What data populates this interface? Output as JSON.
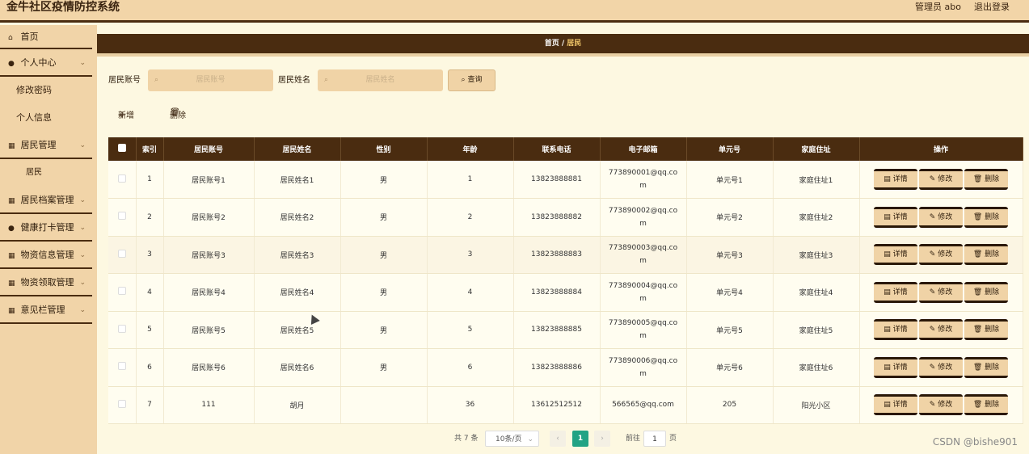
{
  "header": {
    "title": "金牛社区疫情防控系统",
    "user": "管理员 abo",
    "logout": "退出登录"
  },
  "sidebar": {
    "home": "首页",
    "personal_center": "个人中心",
    "change_password": "修改密码",
    "personal_info": "个人信息",
    "resident_mgmt": "居民管理",
    "resident": "居民",
    "resident_archive_mgmt": "居民档案管理",
    "health_checkin_mgmt": "健康打卡管理",
    "supplies_info_mgmt": "物资信息管理",
    "supplies_claim_mgmt": "物资领取管理",
    "feedback_mgmt": "意见栏管理"
  },
  "breadcrumb": {
    "home": "首页",
    "sep": "/",
    "current": "居民"
  },
  "search": {
    "account_label": "居民账号",
    "account_placeholder": "居民账号",
    "name_label": "居民姓名",
    "name_placeholder": "居民姓名",
    "query_button": "查询"
  },
  "actions": {
    "add": "新增",
    "delete": "删除"
  },
  "table": {
    "columns": [
      "索引",
      "居民账号",
      "居民姓名",
      "性别",
      "年龄",
      "联系电话",
      "电子邮箱",
      "单元号",
      "家庭住址",
      "操作"
    ],
    "row_buttons": {
      "detail": "详情",
      "edit": "修改",
      "delete": "删除"
    },
    "rows": [
      {
        "index": "1",
        "account": "居民账号1",
        "name": "居民姓名1",
        "gender": "男",
        "age": "1",
        "phone": "13823888881",
        "email": "773890001@qq.com",
        "unit": "单元号1",
        "address": "家庭住址1"
      },
      {
        "index": "2",
        "account": "居民账号2",
        "name": "居民姓名2",
        "gender": "男",
        "age": "2",
        "phone": "13823888882",
        "email": "773890002@qq.com",
        "unit": "单元号2",
        "address": "家庭住址2"
      },
      {
        "index": "3",
        "account": "居民账号3",
        "name": "居民姓名3",
        "gender": "男",
        "age": "3",
        "phone": "13823888883",
        "email": "773890003@qq.com",
        "unit": "单元号3",
        "address": "家庭住址3"
      },
      {
        "index": "4",
        "account": "居民账号4",
        "name": "居民姓名4",
        "gender": "男",
        "age": "4",
        "phone": "13823888884",
        "email": "773890004@qq.com",
        "unit": "单元号4",
        "address": "家庭住址4"
      },
      {
        "index": "5",
        "account": "居民账号5",
        "name": "居民姓名5",
        "gender": "男",
        "age": "5",
        "phone": "13823888885",
        "email": "773890005@qq.com",
        "unit": "单元号5",
        "address": "家庭住址5"
      },
      {
        "index": "6",
        "account": "居民账号6",
        "name": "居民姓名6",
        "gender": "男",
        "age": "6",
        "phone": "13823888886",
        "email": "773890006@qq.com",
        "unit": "单元号6",
        "address": "家庭住址6"
      },
      {
        "index": "7",
        "account": "111",
        "name": "胡月",
        "gender": "",
        "age": "36",
        "phone": "13612512512",
        "email": "566565@qq.com",
        "unit": "205",
        "address": "阳光小区"
      }
    ]
  },
  "pagination": {
    "total": "共 7 条",
    "page_size": "10条/页",
    "current_page": "1",
    "goto_label": "前往",
    "goto_value": "1",
    "page_unit": "页"
  },
  "watermark": "CSDN @bishe901"
}
